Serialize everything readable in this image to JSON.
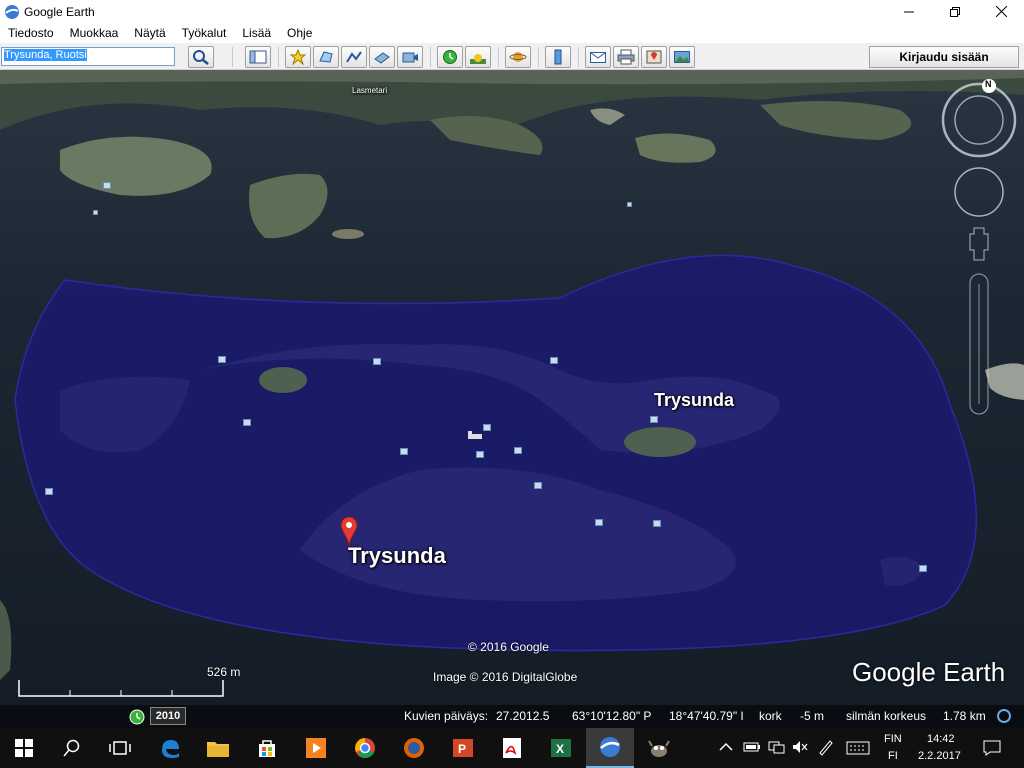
{
  "window": {
    "title": "Google Earth"
  },
  "menu": [
    "Tiedosto",
    "Muokkaa",
    "Näytä",
    "Työkalut",
    "Lisää",
    "Ohje"
  ],
  "search": {
    "value": "Trysunda, Ruotsi"
  },
  "toolbar": {
    "signin_label": "Kirjaudu sisään"
  },
  "map": {
    "labels": {
      "main": "Trysunda",
      "secondary": "Trysunda",
      "top_small": "Lasmetari"
    },
    "copyright": "© 2016 Google",
    "imagery": "Image © 2016 DigitalGlobe",
    "brand": "Google Earth",
    "scale": "526 m",
    "year": "2010",
    "compass_letter": "N"
  },
  "status": {
    "date_label": "Kuvien päiväys:",
    "date_value": "27.2012.5",
    "lat": "63°10'12.80\" P",
    "lon": "18°47'40.79\" I",
    "alt_label": "kork",
    "alt_value": "-5 m",
    "eye_label": "silmän korkeus",
    "eye_value": "1.78 km"
  },
  "taskbar": {
    "lang1": "FIN",
    "lang2": "FI",
    "time": "14:42",
    "date": "2.2.2017"
  },
  "colors": {
    "overlay": "#1a1a6e",
    "water": "#1e2a3a",
    "accent": "#76b9ed"
  }
}
